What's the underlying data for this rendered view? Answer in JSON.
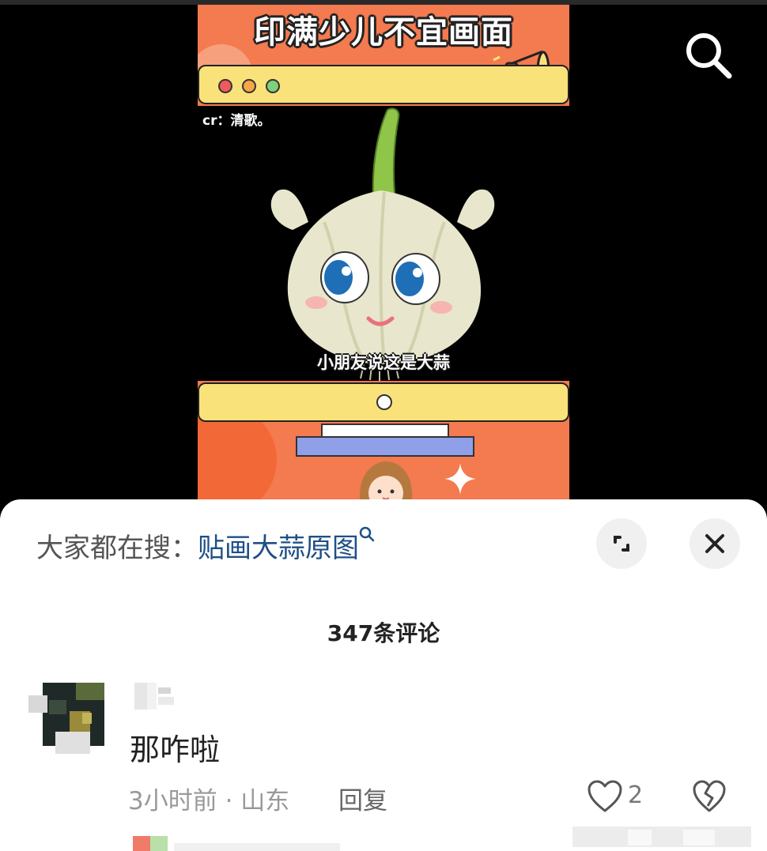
{
  "video": {
    "title": "印满少儿不宜画面",
    "credit": "cr：清歌。",
    "subtitle": "小朋友说这是大蒜",
    "search_icon": "search-icon",
    "colors": {
      "poster_orange": "#f47a4f",
      "bar_yellow": "#f9e27a"
    }
  },
  "sheet": {
    "hot_search_prefix": "大家都在搜：",
    "hot_search_term": "贴画大蒜原图",
    "hot_search_icon": "search-mini-icon",
    "expand_icon": "expand-icon",
    "close_icon": "close-icon",
    "comment_count": "347条评论"
  },
  "comments": [
    {
      "text": "那咋啦",
      "time_location": "3小时前 · 山东",
      "reply_label": "回复",
      "likes": "2",
      "like_icon": "heart-icon",
      "dislike_icon": "broken-heart-icon"
    }
  ]
}
